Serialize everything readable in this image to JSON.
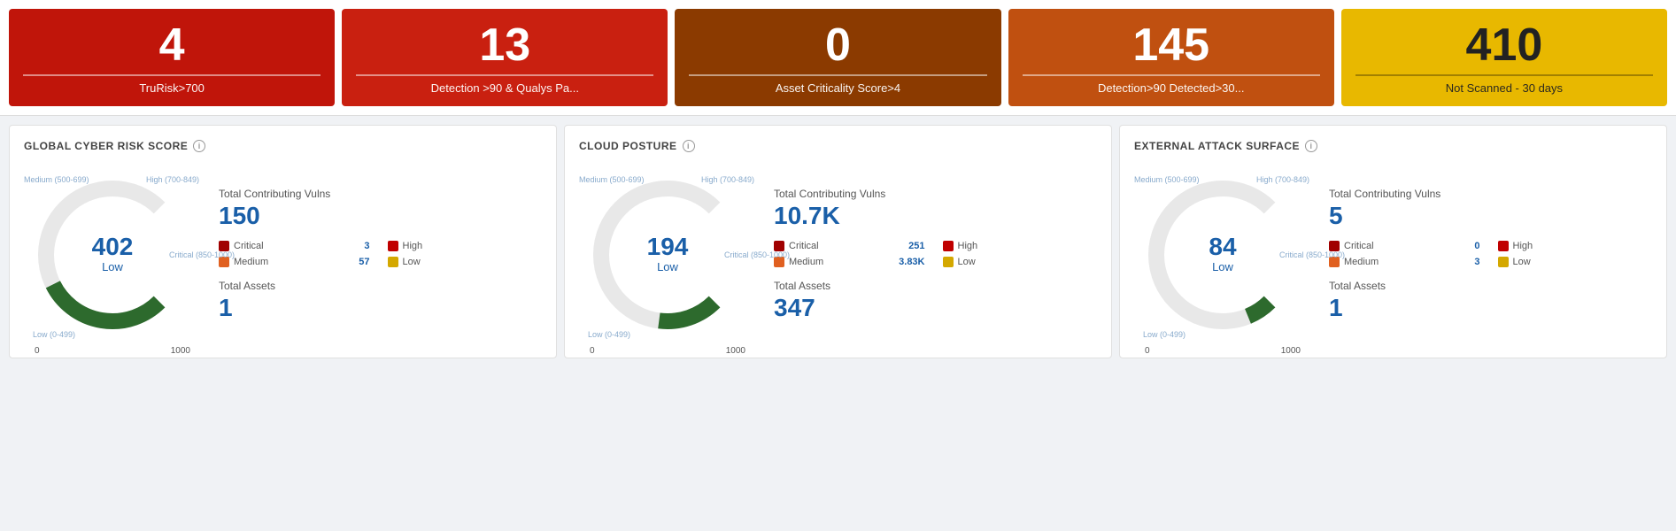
{
  "topCards": [
    {
      "id": "trurisk",
      "value": "4",
      "label": "TruRisk>700",
      "colorClass": "card-red"
    },
    {
      "id": "detection90",
      "value": "13",
      "label": "Detection >90 & Qualys Pa...",
      "colorClass": "card-red2"
    },
    {
      "id": "criticality",
      "value": "0",
      "label": "Asset Criticality Score>4",
      "colorClass": "card-brown"
    },
    {
      "id": "detected30",
      "value": "145",
      "label": "Detection>90 Detected>30...",
      "colorClass": "card-orange"
    },
    {
      "id": "notscanned",
      "value": "410",
      "label": "Not Scanned - 30 days",
      "colorClass": "card-yellow"
    }
  ],
  "panels": [
    {
      "id": "global-cyber",
      "title": "GLOBAL CYBER RISK SCORE",
      "donutValue": "402",
      "donutLabel": "Low",
      "totalVulnsLabel": "Total Contributing Vulns",
      "totalVulnsValue": "150",
      "vulns": [
        {
          "name": "Critical",
          "count": "3",
          "colorClass": "dot-critical"
        },
        {
          "name": "High",
          "count": "",
          "colorClass": "dot-high"
        },
        {
          "name": "Medium",
          "count": "57",
          "colorClass": "dot-medium"
        },
        {
          "name": "Low",
          "count": "",
          "colorClass": "dot-low"
        }
      ],
      "totalAssetsLabel": "Total Assets",
      "totalAssetsValue": "1",
      "axisLabels": {
        "topRight": "High (700-849)",
        "right": "Critical (850-1000)",
        "bottomRight": "",
        "bottomLeft": "Low (0-499)",
        "left": "Medium (500-699)"
      }
    },
    {
      "id": "cloud-posture",
      "title": "CLOUD POSTURE",
      "donutValue": "194",
      "donutLabel": "Low",
      "totalVulnsLabel": "Total Contributing Vulns",
      "totalVulnsValue": "10.7K",
      "vulns": [
        {
          "name": "Critical",
          "count": "251",
          "colorClass": "dot-critical"
        },
        {
          "name": "High",
          "count": "",
          "colorClass": "dot-high"
        },
        {
          "name": "Medium",
          "count": "3.83K",
          "colorClass": "dot-medium"
        },
        {
          "name": "Low",
          "count": "",
          "colorClass": "dot-low"
        }
      ],
      "totalAssetsLabel": "Total Assets",
      "totalAssetsValue": "347",
      "axisLabels": {
        "topRight": "High (700-849)",
        "right": "Critical (850-1000)",
        "bottomLeft": "Low (0-499)",
        "left": "Medium (500-699)"
      }
    },
    {
      "id": "external-attack",
      "title": "EXTERNAL ATTACK SURFACE",
      "donutValue": "84",
      "donutLabel": "Low",
      "totalVulnsLabel": "Total Contributing Vulns",
      "totalVulnsValue": "5",
      "vulns": [
        {
          "name": "Critical",
          "count": "0",
          "colorClass": "dot-critical"
        },
        {
          "name": "High",
          "count": "",
          "colorClass": "dot-high"
        },
        {
          "name": "Medium",
          "count": "3",
          "colorClass": "dot-medium"
        },
        {
          "name": "Low",
          "count": "",
          "colorClass": "dot-low"
        }
      ],
      "totalAssetsLabel": "Total Assets",
      "totalAssetsValue": "1",
      "axisLabels": {
        "topRight": "High (700-849)",
        "right": "Critical (850-1000)",
        "bottomLeft": "Low (0-499)",
        "left": "Medium (500-699)"
      }
    }
  ],
  "labels": {
    "infoIcon": "i",
    "axisMin": "0",
    "axisMax": "1000"
  }
}
